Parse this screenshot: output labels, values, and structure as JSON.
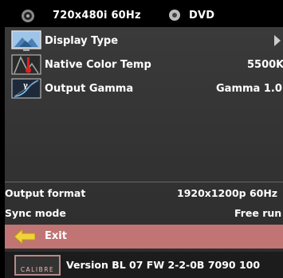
{
  "status_bar": {
    "resolution": "720x480i 60Hz",
    "source": "DVD"
  },
  "menu": {
    "items": [
      {
        "label": "Display Type",
        "value": "",
        "icon": "display-type-icon",
        "arrow": "right-arrow-icon"
      },
      {
        "label": "Native Color Temp",
        "value": "5500K",
        "icon": "thermometer-icon"
      },
      {
        "label": "Output Gamma",
        "value": "Gamma 1.0",
        "icon": "gamma-curve-icon"
      }
    ]
  },
  "info": {
    "output_format_label": "Output format",
    "output_format_value": "1920x1200p 60Hz",
    "sync_mode_label": "Sync mode",
    "sync_mode_value": "Free run"
  },
  "exit": {
    "label": "Exit",
    "icon": "left-arrow-icon"
  },
  "footer": {
    "logo_text": "CALIBRE",
    "version": "Version BL 07 FW 2-2-0B 7090 100"
  },
  "colors": {
    "panel": "#333333",
    "exit_highlight": "#c07474",
    "arrow_yellow": "#f0d23a"
  }
}
